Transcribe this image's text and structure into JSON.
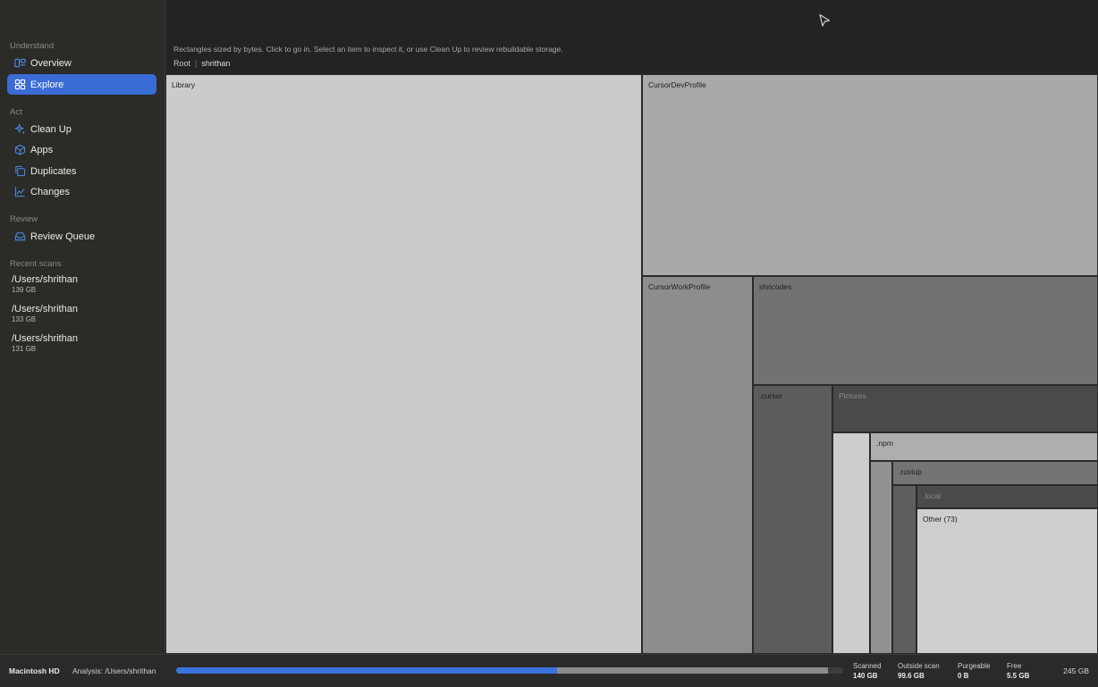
{
  "sidebar": {
    "sections": {
      "understand": "Understand",
      "act": "Act",
      "review": "Review",
      "recent": "Recent scans"
    },
    "items": {
      "overview": {
        "label": "Overview",
        "icon": "overview-icon"
      },
      "explore": {
        "label": "Explore",
        "icon": "grid-icon",
        "active": true
      },
      "cleanup": {
        "label": "Clean Up",
        "icon": "sparkle-icon"
      },
      "apps": {
        "label": "Apps",
        "icon": "cube-icon"
      },
      "duplicates": {
        "label": "Duplicates",
        "icon": "duplicates-icon"
      },
      "changes": {
        "label": "Changes",
        "icon": "chart-icon"
      },
      "review_queue": {
        "label": "Review Queue",
        "icon": "tray-icon"
      }
    },
    "recent_scans": [
      {
        "path": "/Users/shrithan",
        "size": "139 GB"
      },
      {
        "path": "/Users/shrithan",
        "size": "133 GB"
      },
      {
        "path": "/Users/shrithan",
        "size": "131 GB"
      }
    ]
  },
  "header": {
    "hint": "Rectangles sized by bytes. Click to go in. Select an item to inspect it, or use Clean Up to review rebuildable storage.",
    "breadcrumb": {
      "root": "Root",
      "current": "shrithan"
    }
  },
  "treemap": {
    "cells": [
      {
        "label": "Library"
      },
      {
        "label": "CursorDevProfile"
      },
      {
        "label": "CursorWorkProfile"
      },
      {
        "label": "shricodes"
      },
      {
        "label": ".cursor"
      },
      {
        "label": "Pictures"
      },
      {
        "label": ".npm"
      },
      {
        "label": ".rustup"
      },
      {
        "label": ".local"
      },
      {
        "label": "Other (73)"
      }
    ]
  },
  "footer": {
    "volume": "Macintosh HD",
    "analysis": "Analysis: /Users/shrithan",
    "progress": {
      "scanned_fraction": 0.571,
      "outside_fraction": 0.406
    },
    "stats": {
      "scanned": {
        "label": "Scanned",
        "value": "140 GB"
      },
      "outside": {
        "label": "Outside scan",
        "value": "99.6 GB"
      },
      "purgeable": {
        "label": "Purgeable",
        "value": "0 B"
      },
      "free": {
        "label": "Free",
        "value": "5.5 GB"
      }
    },
    "total": "245 GB"
  },
  "colors": {
    "accent": "#3a6cd6",
    "scanned_bar": "#3a73e0",
    "outside_bar": "#8b8b8b"
  }
}
